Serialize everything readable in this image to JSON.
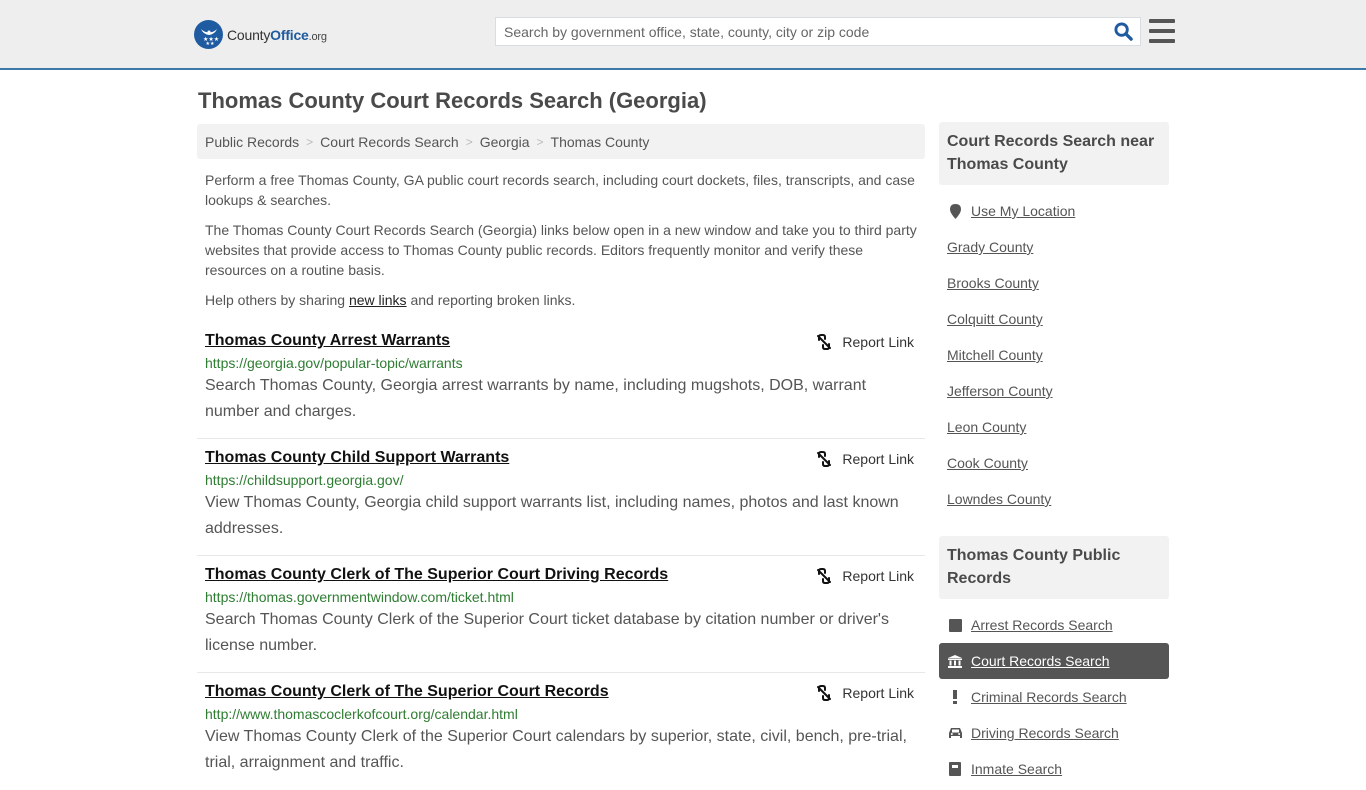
{
  "header": {
    "logo": {
      "name_part1": "County",
      "name_part2": "Office",
      "tld": ".org"
    },
    "search": {
      "placeholder": "Search by government office, state, county, city or zip code",
      "value": ""
    },
    "colors": {
      "brand": "#1e5ba0",
      "header_border": "#3d79a8"
    }
  },
  "page": {
    "title": "Thomas County Court Records Search (Georgia)"
  },
  "breadcrumb": [
    {
      "label": "Public Records"
    },
    {
      "label": "Court Records Search"
    },
    {
      "label": "Georgia"
    },
    {
      "label": "Thomas County"
    }
  ],
  "intro": {
    "p1": "Perform a free Thomas County, GA public court records search, including court dockets, files, transcripts, and case lookups & searches.",
    "p2": "The Thomas County Court Records Search (Georgia) links below open in a new window and take you to third party websites that provide access to Thomas County public records. Editors frequently monitor and verify these resources on a routine basis.",
    "p3_before": "Help others by sharing ",
    "p3_link": "new links",
    "p3_after": " and reporting broken links."
  },
  "links": [
    {
      "title": "Thomas County Arrest Warrants",
      "url": "https://georgia.gov/popular-topic/warrants",
      "description": "Search Thomas County, Georgia arrest warrants by name, including mugshots, DOB, warrant number and charges.",
      "report_label": "Report Link"
    },
    {
      "title": "Thomas County Child Support Warrants",
      "url": "https://childsupport.georgia.gov/",
      "description": "View Thomas County, Georgia child support warrants list, including names, photos and last known addresses.",
      "report_label": "Report Link"
    },
    {
      "title": "Thomas County Clerk of The Superior Court Driving Records",
      "url": "https://thomas.governmentwindow.com/ticket.html",
      "description": "Search Thomas County Clerk of the Superior Court ticket database by citation number or driver's license number.",
      "report_label": "Report Link"
    },
    {
      "title": "Thomas County Clerk of The Superior Court Records",
      "url": "http://www.thomascoclerkofcourt.org/calendar.html",
      "description": "View Thomas County Clerk of the Superior Court calendars by superior, state, civil, bench, pre-trial, trial, arraignment and traffic.",
      "report_label": "Report Link"
    }
  ],
  "sidebar": {
    "nearby": {
      "heading": "Court Records Search near Thomas County",
      "use_location": "Use My Location",
      "counties": [
        "Grady County",
        "Brooks County",
        "Colquitt County",
        "Mitchell County",
        "Jefferson County",
        "Leon County",
        "Cook County",
        "Lowndes County"
      ]
    },
    "public_records": {
      "heading": "Thomas County Public Records",
      "items": [
        {
          "label": "Arrest Records Search",
          "icon": "square-icon",
          "active": false
        },
        {
          "label": "Court Records Search",
          "icon": "courthouse-icon",
          "active": true
        },
        {
          "label": "Criminal Records Search",
          "icon": "exclamation-icon",
          "active": false
        },
        {
          "label": "Driving Records Search",
          "icon": "car-icon",
          "active": false
        },
        {
          "label": "Inmate Search",
          "icon": "inmate-icon",
          "active": false
        }
      ]
    }
  }
}
